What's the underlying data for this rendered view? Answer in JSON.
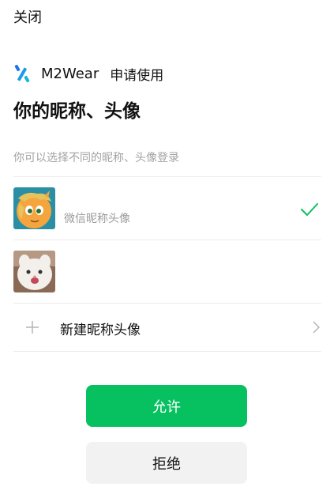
{
  "header": {
    "close_label": "关闭"
  },
  "app": {
    "name": "M2Wear",
    "request_text": "申请使用",
    "logo_icon": "m2wear-logo-icon",
    "logo_color": "#1a73e8"
  },
  "title": "你的昵称、头像",
  "subtitle": "你可以选择不同的昵称、头像登录",
  "accounts": [
    {
      "label": "微信昵称头像",
      "avatar_icon": "pony-avatar",
      "selected": true
    },
    {
      "label": "",
      "avatar_icon": "cat-avatar",
      "selected": false
    }
  ],
  "new_profile": {
    "label": "新建昵称头像",
    "icon": "plus-icon",
    "chevron": "chevron-right-icon"
  },
  "buttons": {
    "allow_label": "允许",
    "deny_label": "拒绝"
  },
  "colors": {
    "accent": "#07c160",
    "check": "#07c160",
    "deny_bg": "#f2f2f2"
  }
}
